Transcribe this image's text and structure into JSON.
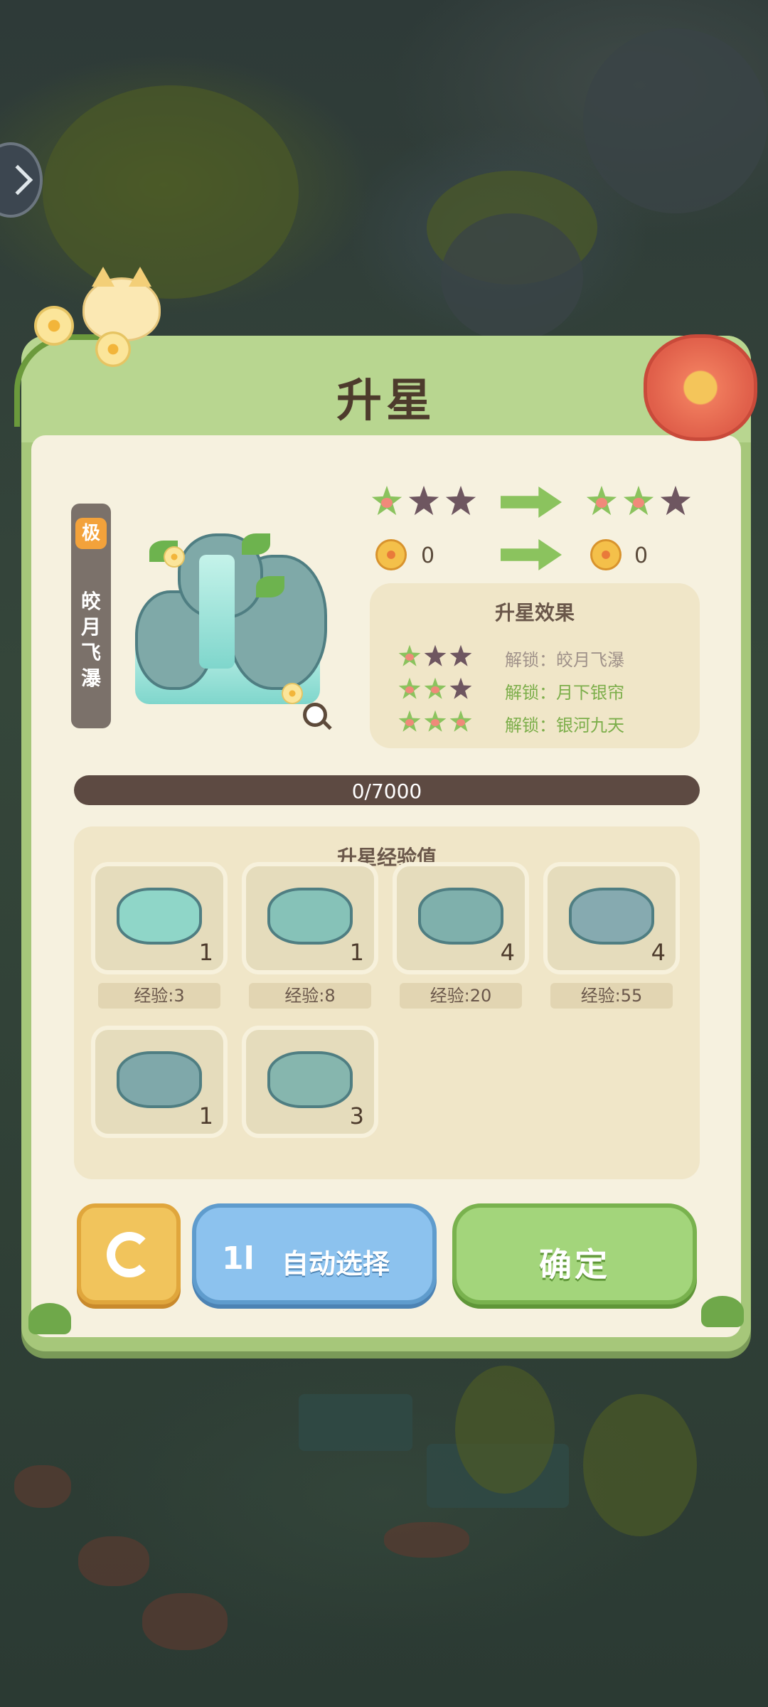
{
  "title": "升星",
  "item": {
    "rarity": "极",
    "name": "皎月飞瀑"
  },
  "star_upgrade": {
    "current_stars": 1,
    "next_stars": 2,
    "max_stars": 3,
    "current_value": "0",
    "next_value": "0"
  },
  "effect": {
    "title": "升星效果",
    "rows": [
      {
        "stars": 1,
        "text": "解锁：皎月飞瀑",
        "color": "#a0928a"
      },
      {
        "stars": 2,
        "text": "解锁：月下银帘",
        "color": "#7cae4a"
      },
      {
        "stars": 3,
        "text": "解锁：银河九天",
        "color": "#7cae4a"
      }
    ]
  },
  "progress": {
    "text": "0/7000",
    "fraction": 0
  },
  "exp": {
    "title": "升星经验值",
    "items": [
      {
        "count": "1",
        "exp": "经验:3"
      },
      {
        "count": "1",
        "exp": "经验:8"
      },
      {
        "count": "4",
        "exp": "经验:20"
      },
      {
        "count": "4",
        "exp": "经验:55"
      },
      {
        "count": "1",
        "exp": ""
      },
      {
        "count": "3",
        "exp": ""
      }
    ]
  },
  "buttons": {
    "refresh_icon": "refresh-icon",
    "auto_icon_glyph": "1l",
    "auto_label": "自动选择",
    "confirm_label": "确定"
  },
  "colors": {
    "panel_green": "#a6c77a",
    "star_on": "#8bc35e",
    "star_off": "#6e5660",
    "button_blue": "#8cc2ee",
    "button_green": "#a3d57b",
    "button_yellow": "#f1c45c"
  }
}
